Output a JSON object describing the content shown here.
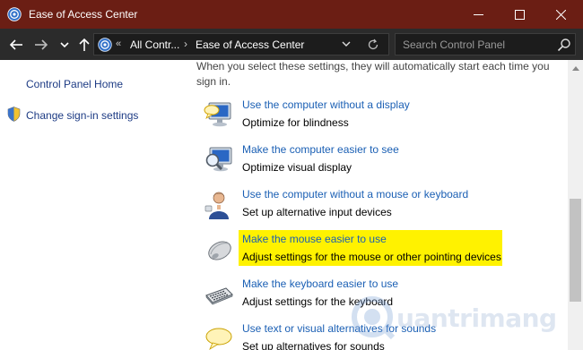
{
  "window": {
    "title": "Ease of Access Center"
  },
  "toolbar": {
    "breadcrumb_sep": "«",
    "crumbs": [
      "All Contr...",
      "Ease of Access Center"
    ],
    "crumb_arrow": "›",
    "search_placeholder": "Search Control Panel"
  },
  "sidebar": {
    "home": "Control Panel Home",
    "signin": "Change sign-in settings"
  },
  "main": {
    "intro": "When you select these settings, they will automatically start each time you sign in.",
    "options": [
      {
        "icon": "display-speech-icon",
        "link": "Use the computer without a display",
        "desc": "Optimize for blindness"
      },
      {
        "icon": "magnifier-monitor-icon",
        "link": "Make the computer easier to see",
        "desc": "Optimize visual display"
      },
      {
        "icon": "person-icon",
        "link": "Use the computer without a mouse or keyboard",
        "desc": "Set up alternative input devices"
      },
      {
        "icon": "mouse-icon",
        "link": "Make the mouse easier to use",
        "desc": "Adjust settings for the mouse or other pointing devices",
        "highlighted": true
      },
      {
        "icon": "keyboard-icon",
        "link": "Make the keyboard easier to use",
        "desc": "Adjust settings for the keyboard"
      },
      {
        "icon": "speech-bubble-icon",
        "link": "Use text or visual alternatives for sounds",
        "desc": "Set up alternatives for sounds"
      }
    ]
  },
  "watermark": {
    "text": "uantrimang"
  },
  "colors": {
    "titlebar": "#6b1e14",
    "toolbar": "#2b2b2b",
    "link": "#1a5fb4",
    "highlight": "#fff200"
  }
}
